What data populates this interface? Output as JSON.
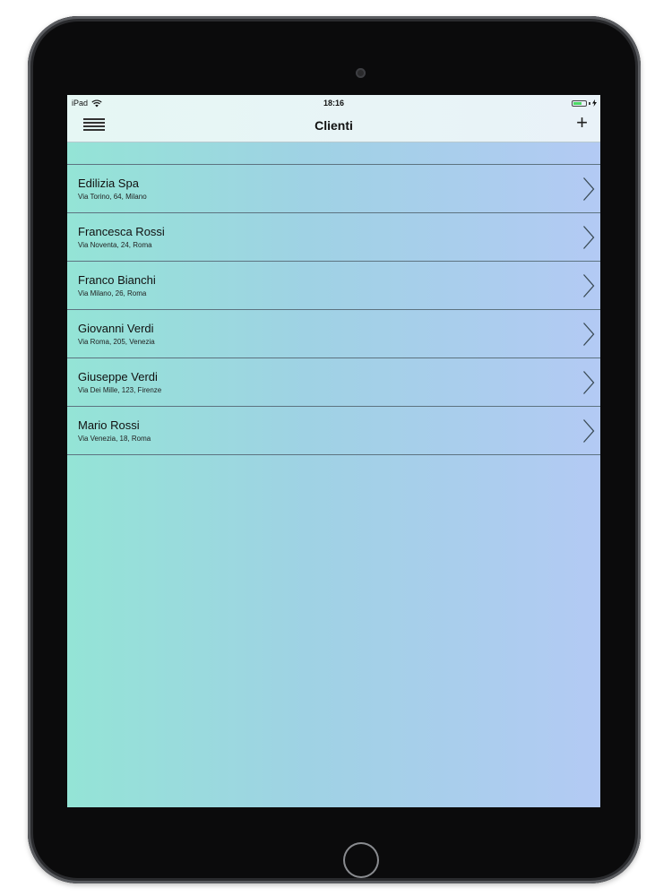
{
  "status_bar": {
    "device": "iPad",
    "time": "18:16",
    "battery_level": 0.75,
    "icons": [
      "wifi-icon",
      "battery-icon",
      "charging-icon"
    ]
  },
  "nav_bar": {
    "title": "Clienti",
    "menu_icon": "menu-icon",
    "add_label": "+"
  },
  "clients": [
    {
      "name": "Edilizia Spa",
      "address": "Via Torino, 64, Milano"
    },
    {
      "name": "Francesca Rossi",
      "address": "Via Noventa, 24, Roma"
    },
    {
      "name": "Franco Bianchi",
      "address": "Via Milano, 26, Roma"
    },
    {
      "name": "Giovanni Verdi",
      "address": "Via Roma, 205, Venezia"
    },
    {
      "name": "Giuseppe Verdi",
      "address": "Via Dei Mille, 123, Firenze"
    },
    {
      "name": "Mario Rossi",
      "address": "Via Venezia, 18, Roma"
    }
  ],
  "colors": {
    "gradient_left": "#94e4d6",
    "gradient_right": "#b3caf4",
    "separator": "#5d7380"
  }
}
